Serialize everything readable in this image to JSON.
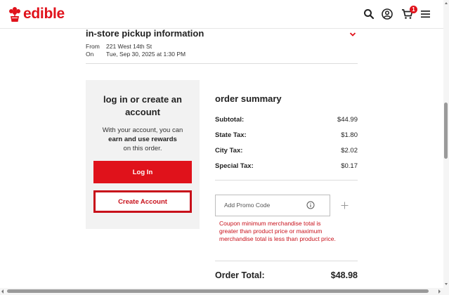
{
  "brand": {
    "name": "edible",
    "color": "#e0121b"
  },
  "header": {
    "icons": [
      "search-icon",
      "account-icon",
      "cart-icon",
      "menu-icon"
    ],
    "cart_count": "1"
  },
  "pickup": {
    "title": "in-store pickup information",
    "from_label": "From",
    "from_value": "221 West 14th St",
    "on_label": "On",
    "on_value": "Tue, Sep 30, 2025 at 1:30 PM"
  },
  "login_card": {
    "title": "log in or create an account",
    "desc_pre": "With your account, you can",
    "desc_bold": "earn and use rewards",
    "desc_post": "on this order.",
    "login_label": "Log In",
    "create_label": "Create Account"
  },
  "order_summary": {
    "title": "order summary",
    "rows": [
      {
        "label": "Subtotal:",
        "value": "$44.99"
      },
      {
        "label": "State Tax:",
        "value": "$1.80"
      },
      {
        "label": "City Tax:",
        "value": "$2.02"
      },
      {
        "label": "Special Tax:",
        "value": "$0.17"
      }
    ],
    "promo_placeholder": "Add Promo Code",
    "promo_error": "Coupon minimum merchandise total is greater than product price or maximum merchandise total is less than product price.",
    "total_label": "Order Total:",
    "total_value": "$48.98"
  }
}
